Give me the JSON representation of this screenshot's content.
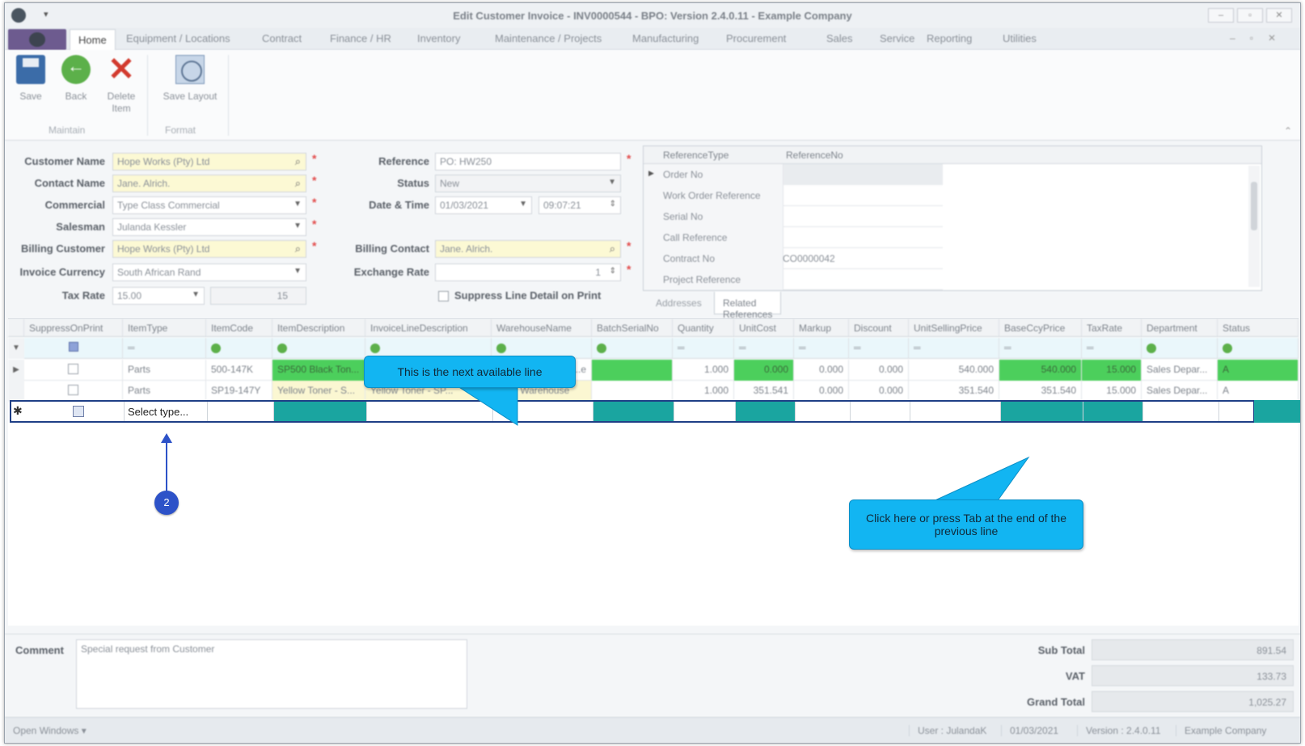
{
  "window": {
    "title": "Edit Customer Invoice - INV0000544 - BPO: Version 2.4.0.11 - Example Company"
  },
  "ribbon_tabs": [
    "Home",
    "Equipment / Locations",
    "Contract",
    "Finance / HR",
    "Inventory",
    "Maintenance / Projects",
    "Manufacturing",
    "Procurement",
    "Sales",
    "Service",
    "Reporting",
    "Utilities"
  ],
  "ribbon": {
    "save": "Save",
    "back": "Back",
    "delete": "Delete Item",
    "save_layout": "Save Layout",
    "group_maintain": "Maintain",
    "group_format": "Format"
  },
  "form": {
    "customer_name_label": "Customer Name",
    "customer_name": "Hope Works (Pty) Ltd",
    "contact_name_label": "Contact Name",
    "contact_name": "Jane. Alrich.",
    "commercial_label": "Commercial",
    "commercial": "Type Class Commercial",
    "salesman_label": "Salesman",
    "salesman": "Julanda Kessler",
    "billing_customer_label": "Billing Customer",
    "billing_customer": "Hope Works (Pty) Ltd",
    "invoice_currency_label": "Invoice Currency",
    "invoice_currency": "South African Rand",
    "tax_rate_label": "Tax Rate",
    "tax_rate": "15.00",
    "tax_rate_value": "15",
    "reference_label": "Reference",
    "reference": "PO: HW250",
    "status_label": "Status",
    "status": "New",
    "date_time_label": "Date & Time",
    "date": "01/03/2021",
    "time": "09:07:21",
    "billing_contact_label": "Billing Contact",
    "billing_contact": "Jane. Alrich.",
    "exchange_rate_label": "Exchange Rate",
    "exchange_rate": "1",
    "suppress_label": "Suppress Line Detail on Print"
  },
  "references": {
    "headers": [
      "ReferenceType",
      "ReferenceNo"
    ],
    "rows": [
      {
        "type": "Order No",
        "no": ""
      },
      {
        "type": "Work Order Reference",
        "no": ""
      },
      {
        "type": "Serial No",
        "no": ""
      },
      {
        "type": "Call Reference",
        "no": ""
      },
      {
        "type": "Contract No",
        "no": "CO0000042"
      },
      {
        "type": "Project Reference",
        "no": ""
      }
    ],
    "tabs": [
      "Addresses",
      "Related References"
    ]
  },
  "grid": {
    "columns": [
      "SuppressOnPrint",
      "ItemType",
      "ItemCode",
      "ItemDescription",
      "InvoiceLineDescription",
      "WarehouseName",
      "BatchSerialNo",
      "Quantity",
      "UnitCost",
      "Markup",
      "Discount",
      "UnitSellingPrice",
      "BaseCcyPrice",
      "TaxRate",
      "Department",
      "Status"
    ],
    "rows": [
      {
        "item_type": "Parts",
        "item_code": "500-147K",
        "item_description": "SP500 Black Ton...",
        "invoice_line_description": "",
        "warehouse": "...e",
        "batch": "",
        "quantity": "1.000",
        "unit_cost": "0.000",
        "markup": "0.000",
        "discount": "0.000",
        "unit_selling_price": "540.000",
        "base_ccy_price": "540.000",
        "tax_rate": "15.000",
        "department": "Sales Depar...",
        "status": "A"
      },
      {
        "item_type": "Parts",
        "item_code": "SP19-147Y",
        "item_description": "Yellow Toner - S...",
        "invoice_line_description": "Yellow Toner - SP...",
        "warehouse": "Main Warehouse",
        "batch": "",
        "quantity": "1.000",
        "unit_cost": "351.541",
        "markup": "0.000",
        "discount": "0.000",
        "unit_selling_price": "351.540",
        "base_ccy_price": "351.540",
        "tax_rate": "15.000",
        "department": "Sales Depar...",
        "status": "A"
      }
    ],
    "new_row_placeholder": "Select type..."
  },
  "comment": {
    "label": "Comment",
    "text": "Special request from Customer"
  },
  "totals": {
    "sub_total_label": "Sub Total",
    "sub_total": "891.54",
    "vat_label": "VAT",
    "vat": "133.73",
    "grand_total_label": "Grand Total",
    "grand_total": "1,025.27"
  },
  "status_bar": {
    "open_windows": "Open Windows",
    "user": "User : JulandaK",
    "date": "01/03/2021",
    "version": "Version : 2.4.0.11",
    "company": "Example Company"
  },
  "annotations": {
    "callout_next_line": "This is the next available line",
    "callout_click_here": "Click here or press Tab at the end of the previous line",
    "step_badge": "2"
  },
  "colors": {
    "callout": "#12b5f2",
    "badge": "#2d52c8",
    "new_row_border": "#1f3f86",
    "teal_cell": "#1aa5a0",
    "green_cell": "#4ccf5c"
  }
}
